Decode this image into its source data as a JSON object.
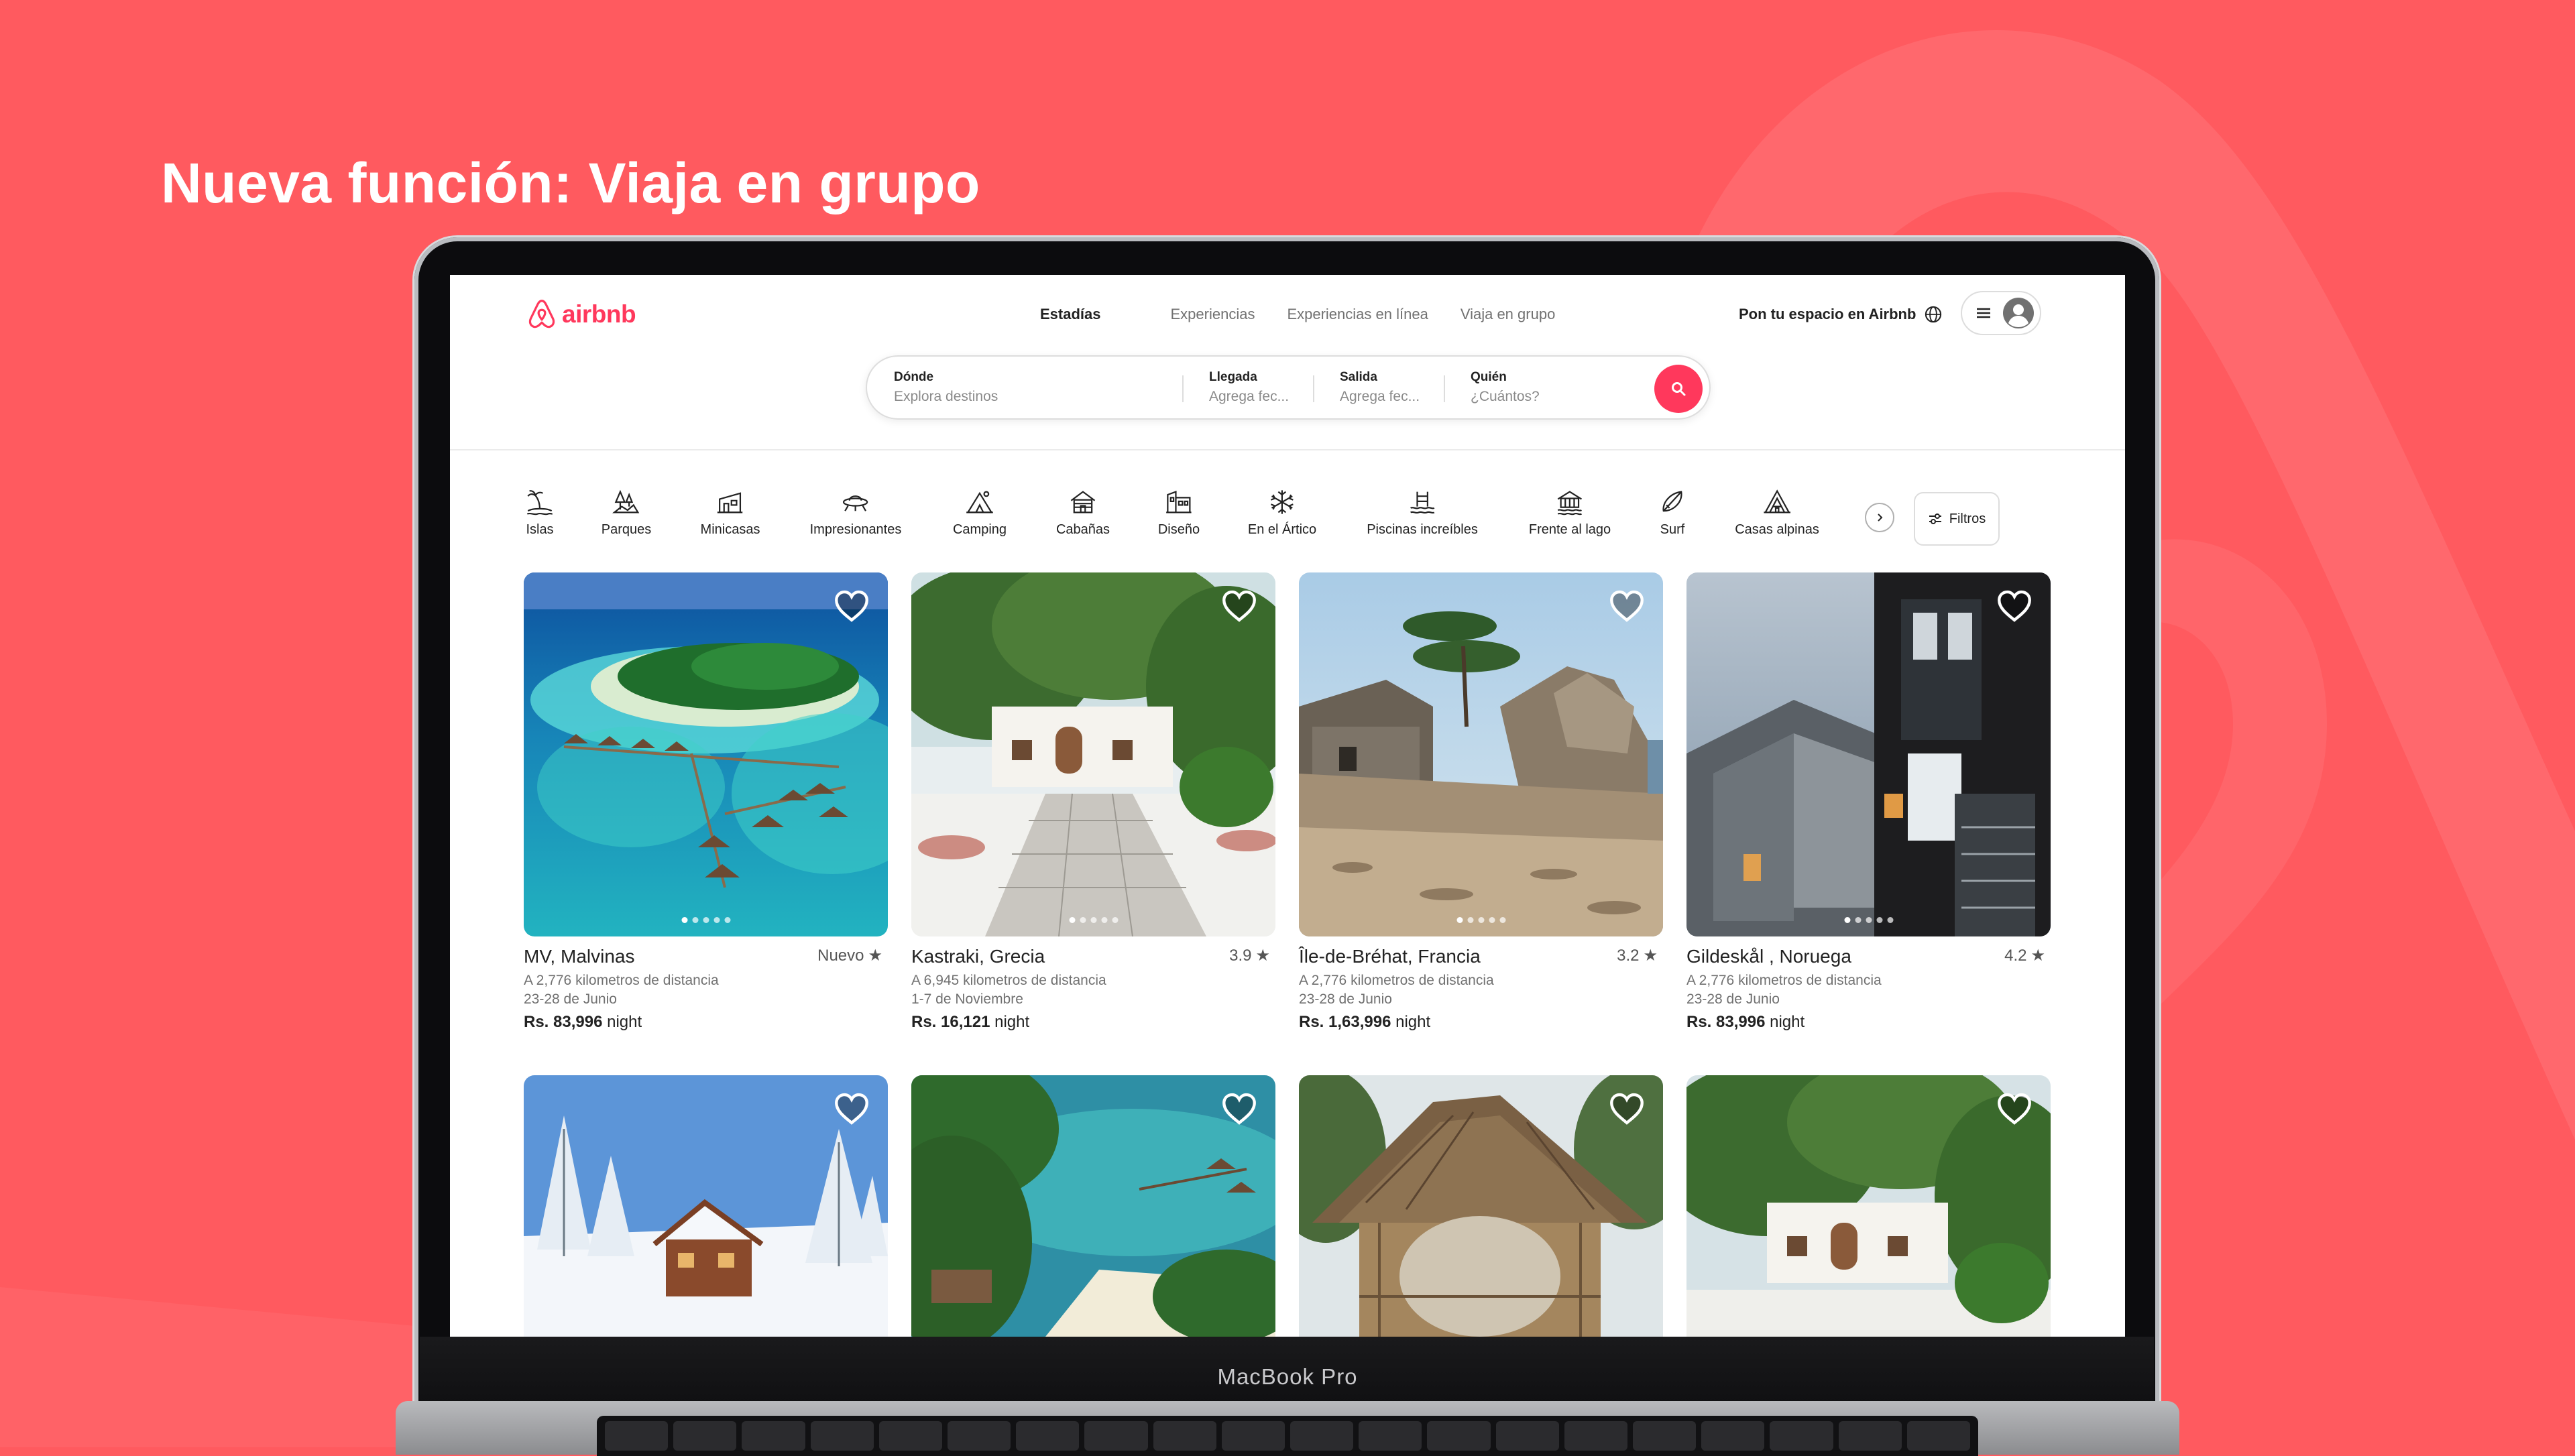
{
  "headline": "Nueva función: Viaja en grupo",
  "device_label": "MacBook Pro",
  "colors": {
    "background": "#FF5A5F",
    "brand": "#FF385C"
  },
  "header": {
    "logo_text": "airbnb",
    "tabs": [
      "Estadías",
      "Experiencias",
      "Experiencias en línea",
      "Viaja en grupo"
    ],
    "host_link": "Pon tu espacio en Airbnb",
    "icons": [
      "globe-icon",
      "menu-icon",
      "avatar-icon"
    ]
  },
  "search": {
    "where_label": "Dónde",
    "where_placeholder": "Explora destinos",
    "checkin_label": "Llegada",
    "checkin_placeholder": "Agrega fec...",
    "checkout_label": "Salida",
    "checkout_placeholder": "Agrega fec...",
    "who_label": "Quién",
    "who_placeholder": "¿Cuántos?"
  },
  "categories": [
    {
      "label": "Islas",
      "icon": "island-icon"
    },
    {
      "label": "Parques",
      "icon": "park-icon"
    },
    {
      "label": "Minicasas",
      "icon": "tiny-home-icon"
    },
    {
      "label": "Impresionantes",
      "icon": "ufo-icon"
    },
    {
      "label": "Camping",
      "icon": "camping-icon"
    },
    {
      "label": "Cabañas",
      "icon": "cabin-icon"
    },
    {
      "label": "Diseño",
      "icon": "design-icon"
    },
    {
      "label": "En el Ártico",
      "icon": "snowflake-icon"
    },
    {
      "label": "Piscinas increíbles",
      "icon": "pool-icon"
    },
    {
      "label": "Frente al lago",
      "icon": "lake-icon"
    },
    {
      "label": "Surf",
      "icon": "surf-icon"
    },
    {
      "label": "Casas alpinas",
      "icon": "a-frame-icon"
    }
  ],
  "filters_label": "Filtros",
  "listings": [
    {
      "title": "MV, Malvinas",
      "rating": "Nuevo",
      "distance": "A 2,776 kilometros de distancia",
      "dates": "23-28 de Junio",
      "price": "Rs. 83,996",
      "price_unit": "night"
    },
    {
      "title": "Kastraki, Grecia",
      "rating": "3.9",
      "distance": "A 6,945  kilometros de distancia",
      "dates": "1-7 de Noviembre",
      "price": "Rs. 16,121",
      "price_unit": "night"
    },
    {
      "title": "Île-de-Bréhat, Francia",
      "rating": "3.2",
      "distance": "A 2,776 kilometros de distancia",
      "dates": "23-28 de Junio",
      "price": "Rs. 1,63,996",
      "price_unit": "night"
    },
    {
      "title": "Gildeskål , Noruega",
      "rating": "4.2",
      "distance": "A 2,776 kilometros de distancia",
      "dates": "23-28 de Junio",
      "price": "Rs. 83,996",
      "price_unit": "night"
    }
  ]
}
